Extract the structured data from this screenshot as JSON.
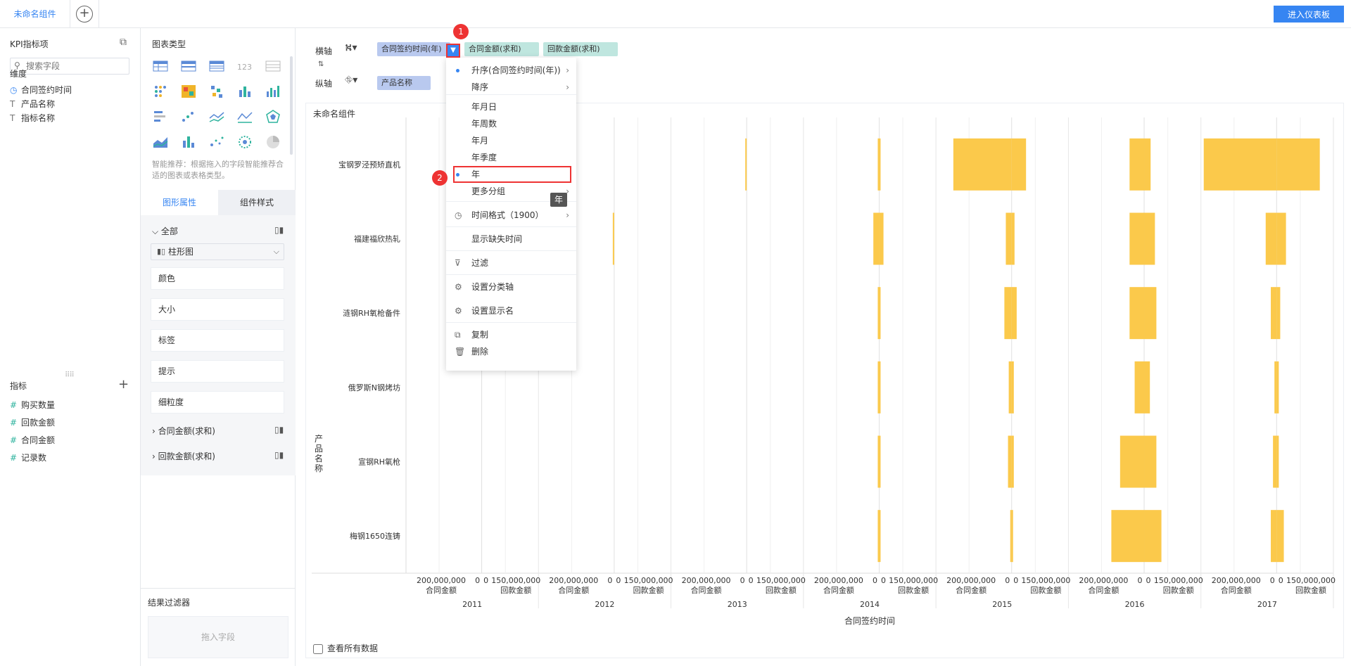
{
  "topbar": {
    "component_tab": "未命名组件",
    "enter_dashboard": "进入仪表板"
  },
  "fields": {
    "title": "KPI指标项",
    "search_placeholder": "搜索字段",
    "dimension_label": "维度",
    "dimensions": [
      {
        "icon": "clock-icon",
        "label": "合同签约时间"
      },
      {
        "icon": "text-field-icon",
        "label": "产品名称"
      },
      {
        "icon": "text-field-icon",
        "label": "指标名称"
      }
    ],
    "metric_label": "指标",
    "metrics": [
      {
        "icon": "hash-icon",
        "label": "购买数量"
      },
      {
        "icon": "hash-icon",
        "label": "回款金额"
      },
      {
        "icon": "hash-icon",
        "label": "合同金额"
      },
      {
        "icon": "hash-icon",
        "label": "记录数"
      }
    ]
  },
  "chart_types": {
    "title": "图表类型",
    "hint": "智能推荐：根据拖入的字段智能推荐合适的图表或表格类型。",
    "tile_labels": {
      "number": "123"
    }
  },
  "properties": {
    "tab_graphic": "图形属性",
    "tab_style": "组件样式",
    "all_label": "全部",
    "chart_type_value": "柱形图",
    "boxes": [
      "颜色",
      "大小",
      "标签",
      "提示",
      "细粒度"
    ],
    "sub_series": [
      "合同金额(求和)",
      "回款金额(求和)"
    ],
    "result_filter": "结果过滤器",
    "drop_field": "拖入字段"
  },
  "axes": {
    "x_label": "横轴",
    "y_label": "纵轴",
    "x_pills": [
      "合同签约时间(年)",
      "合同金额(求和)",
      "回款金额(求和)"
    ],
    "y_pills": [
      "产品名称"
    ]
  },
  "menu": {
    "items": [
      {
        "label": "升序(合同签约时间(年))",
        "dot": true,
        "chev": true
      },
      {
        "label": "降序",
        "chev": true
      },
      {
        "label": "年月日"
      },
      {
        "label": "年周数"
      },
      {
        "label": "年月"
      },
      {
        "label": "年季度"
      },
      {
        "label": "年",
        "dot": true
      },
      {
        "label": "更多分组",
        "chev": true
      },
      {
        "label": "时间格式（1900）",
        "chev": true,
        "icon": "clock-icon"
      },
      {
        "label": "显示缺失时间"
      },
      {
        "label": "过滤",
        "icon": "filter-icon"
      },
      {
        "label": "设置分类轴",
        "icon": "gear-icon"
      },
      {
        "label": "设置显示名",
        "icon": "gear-icon"
      },
      {
        "label": "复制",
        "icon": "copy-icon"
      },
      {
        "label": "删除",
        "icon": "trash-icon"
      }
    ],
    "tooltip": "年",
    "badge1": "1",
    "badge2": "2"
  },
  "chart": {
    "title": "未命名组件",
    "ylabel": "产品名称",
    "show_all_data": "查看所有数据"
  },
  "colors": {
    "accent": "#3685f2",
    "bar": "#fbc94b",
    "highlight": "#ee3333"
  },
  "chart_data": {
    "type": "bar",
    "orientation": "horizontal",
    "xlabel": "合同签约时间",
    "ylabel": "产品名称",
    "years": [
      "2011",
      "2012",
      "2013",
      "2014",
      "2015",
      "2016",
      "2017"
    ],
    "sub_axes": [
      "合同金额",
      "回款金额"
    ],
    "tick_labels_left": [
      "200,000,000",
      "0"
    ],
    "tick_labels_right": [
      "0",
      "150,000,000"
    ],
    "categories": [
      "宝钢罗泾预矫直机",
      "福建福欣热轧",
      "涟钢RH氧枪备件",
      "俄罗斯N钢烤坊",
      "宣钢RH氧枪",
      "梅钢1650连铸"
    ],
    "series": [
      {
        "name": "合同金额",
        "values": [
          [
            0,
            0,
            1000000,
            2000000,
            160000000,
            40000000,
            200000000
          ],
          [
            0,
            1000000,
            0,
            16000000,
            16000000,
            40000000,
            30000000
          ],
          [
            0,
            0,
            0,
            1000000,
            20000000,
            40000000,
            16000000
          ],
          [
            0,
            0,
            0,
            1000000,
            8000000,
            26000000,
            6000000
          ],
          [
            0,
            0,
            0,
            1000000,
            10000000,
            66000000,
            10000000
          ],
          [
            0,
            0,
            0,
            1000000,
            2000000,
            90000000,
            16000000
          ]
        ]
      },
      {
        "name": "回款金额",
        "values": [
          [
            0,
            0,
            0,
            2000000,
            40000000,
            18000000,
            120000000
          ],
          [
            0,
            0,
            0,
            12000000,
            8000000,
            30000000,
            26000000
          ],
          [
            0,
            0,
            0,
            1000000,
            14000000,
            34000000,
            10000000
          ],
          [
            0,
            0,
            0,
            1000000,
            6000000,
            16000000,
            6000000
          ],
          [
            0,
            0,
            0,
            1000000,
            6000000,
            34000000,
            6000000
          ],
          [
            0,
            0,
            0,
            1000000,
            1000000,
            48000000,
            20000000
          ]
        ]
      }
    ],
    "xlim_left": [
      200000000,
      0
    ],
    "xlim_right": [
      0,
      150000000
    ],
    "grid": true
  }
}
